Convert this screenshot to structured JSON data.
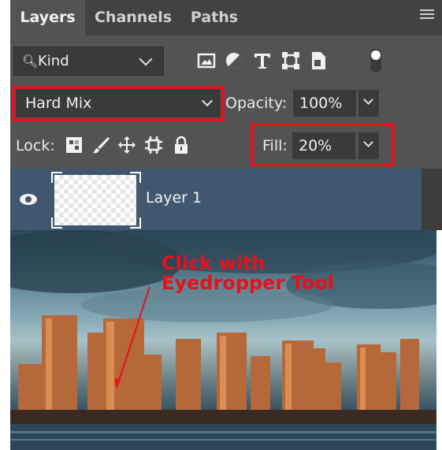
{
  "tabs": [
    "Layers",
    "Channels",
    "Paths"
  ],
  "filter": {
    "kind_label": "Kind",
    "icons": [
      "image-filter-icon",
      "adjustment-filter-icon",
      "type-filter-icon",
      "shape-filter-icon",
      "smart-object-filter-icon",
      "filter-toggle-icon"
    ]
  },
  "blend": {
    "mode": "Hard Mix",
    "opacity_label": "Opacity:",
    "opacity_value": "100%"
  },
  "lock": {
    "label": "Lock:",
    "icons": [
      "lock-transparent-pixels-icon",
      "lock-image-pixels-icon",
      "lock-position-icon",
      "lock-artboard-icon",
      "lock-all-icon"
    ],
    "fill_label": "Fill:",
    "fill_value": "20%"
  },
  "layer": {
    "name": "Layer 1"
  },
  "annotation": {
    "line1": "Click with",
    "line2": "Eyedropper Tool"
  },
  "colors": {
    "highlight": "#e2131e",
    "panel": "#535353",
    "selected_row": "#40576f"
  }
}
